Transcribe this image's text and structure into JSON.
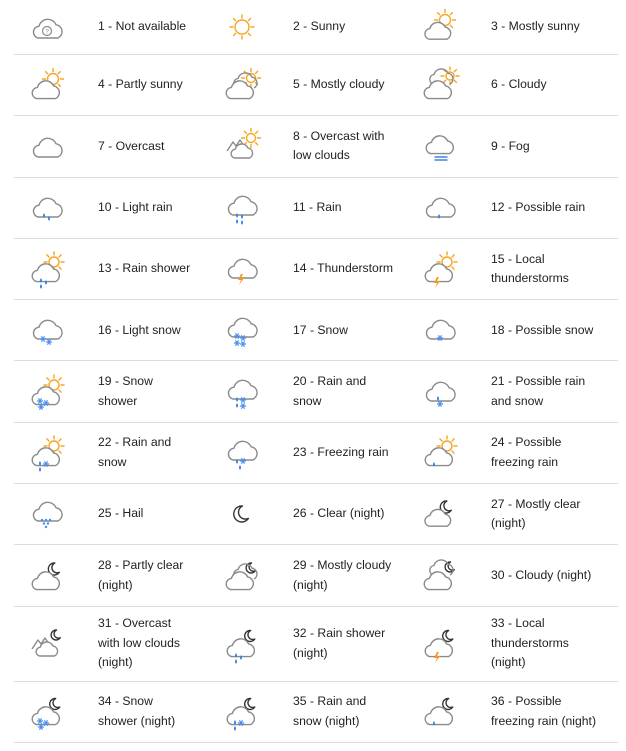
{
  "colors": {
    "cloud": "#8a8a8a",
    "sun": "#f6a623",
    "rain": "#3d82e3",
    "snow": "#4a8ff0",
    "bolt": "#f29a1b",
    "moon": "#333333",
    "divider": "#dddddd"
  },
  "items": [
    {
      "label": "1 - Not available",
      "icon": "not-available-icon"
    },
    {
      "label": "2 - Sunny",
      "icon": "sunny-icon"
    },
    {
      "label": "3 - Mostly sunny",
      "icon": "mostly-sunny-icon"
    },
    {
      "label": "4 - Partly sunny",
      "icon": "partly-sunny-icon"
    },
    {
      "label": "5 - Mostly cloudy",
      "icon": "mostly-cloudy-icon"
    },
    {
      "label": "6 - Cloudy",
      "icon": "cloudy-icon"
    },
    {
      "label": "7 - Overcast",
      "icon": "overcast-icon"
    },
    {
      "label": "8 - Overcast with low clouds",
      "icon": "overcast-low-clouds-icon"
    },
    {
      "label": "9 - Fog",
      "icon": "fog-icon"
    },
    {
      "label": "10 - Light rain",
      "icon": "light-rain-icon"
    },
    {
      "label": "11 - Rain",
      "icon": "rain-icon"
    },
    {
      "label": "12 - Possible rain",
      "icon": "possible-rain-icon"
    },
    {
      "label": "13 - Rain shower",
      "icon": "rain-shower-icon"
    },
    {
      "label": "14 - Thunderstorm",
      "icon": "thunderstorm-icon"
    },
    {
      "label": "15 - Local thunderstorms",
      "icon": "local-thunderstorms-icon"
    },
    {
      "label": "16 - Light snow",
      "icon": "light-snow-icon"
    },
    {
      "label": "17 - Snow",
      "icon": "snow-icon"
    },
    {
      "label": "18 - Possible snow",
      "icon": "possible-snow-icon"
    },
    {
      "label": "19 - Snow shower",
      "icon": "snow-shower-icon"
    },
    {
      "label": "20 - Rain and snow",
      "icon": "rain-and-snow-icon"
    },
    {
      "label": "21 - Possible rain and snow",
      "icon": "possible-rain-and-snow-icon"
    },
    {
      "label": "22 - Rain and snow",
      "icon": "rain-and-snow-sun-icon"
    },
    {
      "label": "23 - Freezing rain",
      "icon": "freezing-rain-icon"
    },
    {
      "label": "24 - Possible freezing rain",
      "icon": "possible-freezing-rain-icon"
    },
    {
      "label": "25 - Hail",
      "icon": "hail-icon"
    },
    {
      "label": "26 - Clear (night)",
      "icon": "clear-night-icon"
    },
    {
      "label": "27 - Mostly clear (night)",
      "icon": "mostly-clear-night-icon"
    },
    {
      "label": "28 - Partly clear (night)",
      "icon": "partly-clear-night-icon"
    },
    {
      "label": "29 - Mostly cloudy (night)",
      "icon": "mostly-cloudy-night-icon"
    },
    {
      "label": "30 - Cloudy (night)",
      "icon": "cloudy-night-icon"
    },
    {
      "label": "31 - Overcast with low clouds (night)",
      "icon": "overcast-low-clouds-night-icon"
    },
    {
      "label": "32 - Rain shower (night)",
      "icon": "rain-shower-night-icon"
    },
    {
      "label": "33 - Local thunderstorms (night)",
      "icon": "local-thunderstorms-night-icon"
    },
    {
      "label": "34 - Snow shower (night)",
      "icon": "snow-shower-night-icon"
    },
    {
      "label": "35 - Rain and snow (night)",
      "icon": "rain-and-snow-night-icon"
    },
    {
      "label": "36 - Possible freezing rain (night)",
      "icon": "possible-freezing-rain-night-icon"
    }
  ]
}
